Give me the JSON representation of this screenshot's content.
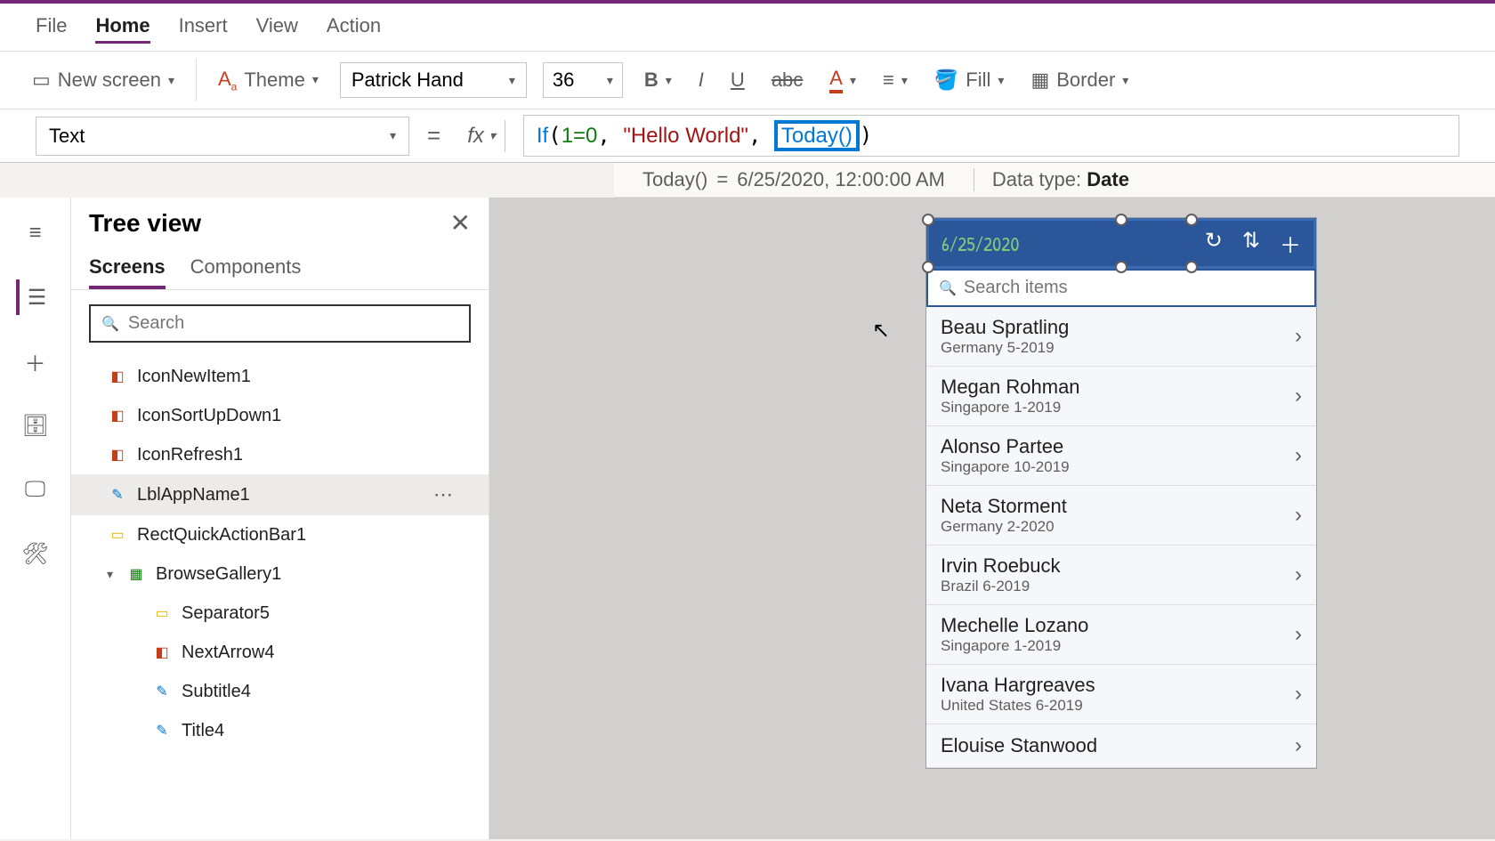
{
  "menu": {
    "file": "File",
    "home": "Home",
    "insert": "Insert",
    "view": "View",
    "action": "Action"
  },
  "toolbar": {
    "new_screen": "New screen",
    "theme": "Theme",
    "font": "Patrick Hand",
    "size": "36",
    "fill": "Fill",
    "border": "Border"
  },
  "formula": {
    "property": "Text",
    "expr_if": "If",
    "expr_cond": "1=0",
    "expr_str": "\"Hello World\"",
    "expr_fn": "Today()",
    "eval_fn": "Today()",
    "eval_val": "6/25/2020, 12:00:00 AM",
    "type_label": "Data type:",
    "type_val": "Date"
  },
  "tree": {
    "title": "Tree view",
    "tab_screens": "Screens",
    "tab_components": "Components",
    "search_placeholder": "Search",
    "items": [
      {
        "name": "IconNewItem1",
        "icon": "◧"
      },
      {
        "name": "IconSortUpDown1",
        "icon": "◧"
      },
      {
        "name": "IconRefresh1",
        "icon": "◧"
      },
      {
        "name": "LblAppName1",
        "icon": "✎",
        "selected": true
      },
      {
        "name": "RectQuickActionBar1",
        "icon": "▭"
      },
      {
        "name": "BrowseGallery1",
        "icon": "▦",
        "expanded": true
      },
      {
        "name": "Separator5",
        "icon": "▭",
        "nested": true
      },
      {
        "name": "NextArrow4",
        "icon": "◧",
        "nested": true
      },
      {
        "name": "Subtitle4",
        "icon": "✎",
        "nested": true
      },
      {
        "name": "Title4",
        "icon": "✎",
        "nested": true
      }
    ]
  },
  "preview": {
    "header_date": "6/25/2020",
    "search_placeholder": "Search items",
    "rows": [
      {
        "name": "Beau Spratling",
        "sub": "Germany 5-2019"
      },
      {
        "name": "Megan Rohman",
        "sub": "Singapore 1-2019"
      },
      {
        "name": "Alonso Partee",
        "sub": "Singapore 10-2019"
      },
      {
        "name": "Neta Storment",
        "sub": "Germany 2-2020"
      },
      {
        "name": "Irvin Roebuck",
        "sub": "Brazil 6-2019"
      },
      {
        "name": "Mechelle Lozano",
        "sub": "Singapore 1-2019"
      },
      {
        "name": "Ivana Hargreaves",
        "sub": "United States 6-2019"
      },
      {
        "name": "Elouise Stanwood",
        "sub": ""
      }
    ]
  }
}
